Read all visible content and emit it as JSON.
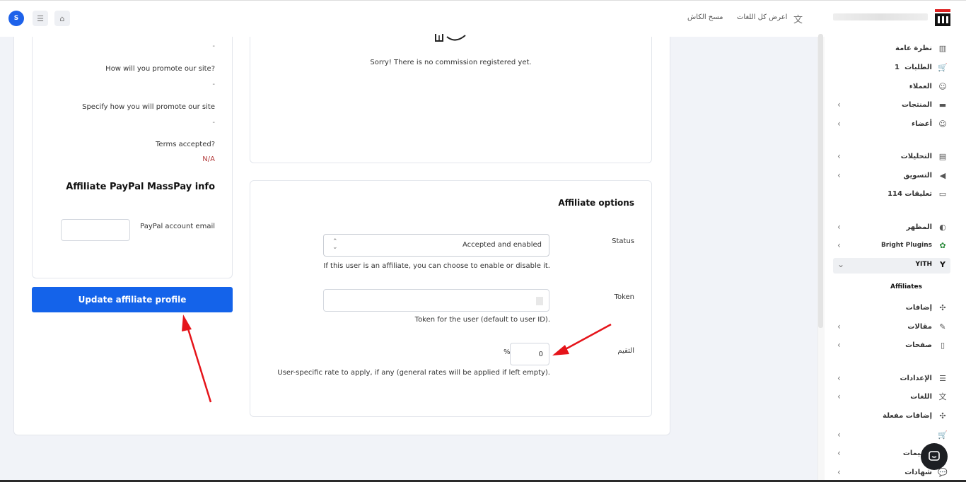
{
  "topbar": {
    "avatar_letter": "S",
    "home_icon": "home-icon",
    "settings_icon": "sliders-icon",
    "translate_link": "اعرض كل اللغات",
    "cache_link": "مسح الكاش"
  },
  "left_panel": {
    "dash1": "-",
    "promote_q": "How will you promote our site?",
    "dash2": "-",
    "specify_q": "Specify how you will promote our site",
    "dash3": "-",
    "terms_q": "Terms accepted?",
    "terms_val": "N/A",
    "paypal_title": "Affiliate PayPal MassPay info",
    "paypal_email_label": "PayPal account email",
    "paypal_email_value": "",
    "update_button": "Update affiliate profile"
  },
  "commissions": {
    "empty_text": "Sorry! There is no commission registered yet."
  },
  "affiliate_options": {
    "title": "Affiliate options",
    "status_label": "Status",
    "status_value": "Accepted and enabled",
    "status_help": "If this user is an affiliate, you can choose to enable or disable it.",
    "token_label": "Token",
    "token_value": "",
    "token_help": "Token for the user (default to user ID).",
    "rate_label": "التقيم",
    "rate_value": "0",
    "rate_unit": "%",
    "rate_help": "User-specific rate to apply, if any (general rates will be applied if left empty)."
  },
  "sidebar": {
    "items": [
      {
        "label": "نظرة عامة",
        "icon": "chart-icon"
      },
      {
        "label": "الطلبات",
        "icon": "cart-icon",
        "count": "1"
      },
      {
        "label": "العملاء",
        "icon": "users-icon"
      },
      {
        "label": "المنتجات",
        "icon": "box-icon"
      },
      {
        "label": "أعضاء",
        "icon": "members-icon"
      },
      {
        "label": "التحليلات",
        "icon": "analytics-icon"
      },
      {
        "label": "التسويق",
        "icon": "megaphone-icon"
      },
      {
        "label": "تعليقات 114",
        "icon": "comments-icon"
      },
      {
        "label": "المظهر",
        "icon": "palette-icon"
      },
      {
        "label": "Bright Plugins",
        "icon": "plugin-icon"
      },
      {
        "label": "YITH",
        "icon": "yith-icon"
      },
      {
        "label": "إضافات",
        "icon": "puzzle-icon"
      },
      {
        "label": "مقالات",
        "icon": "posts-icon"
      },
      {
        "label": "صفحات",
        "icon": "page-icon"
      },
      {
        "label": "الإعدادات",
        "icon": "settings-icon"
      },
      {
        "label": "اللغات",
        "icon": "translate-icon"
      },
      {
        "label": "إضافات مفعلة",
        "icon": "puzzle-icon"
      },
      {
        "label": "",
        "icon": "cart-icon"
      },
      {
        "label": "سميمات",
        "icon": "design-icon"
      },
      {
        "label": "شهادات",
        "icon": "chat-icon"
      }
    ],
    "sub_active": "Affiliates"
  }
}
